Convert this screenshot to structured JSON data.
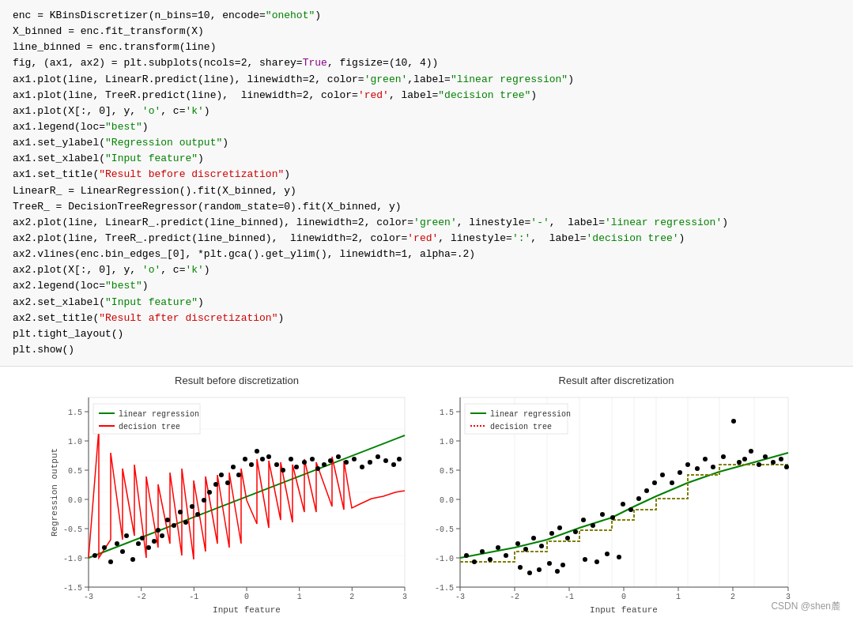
{
  "code": {
    "lines": [
      {
        "text": "enc = KBinsDiscretizer(n_bins=10, encode=\"onehot\")",
        "type": "plain"
      },
      {
        "text": "X_binned = enc.fit_transform(X)",
        "type": "plain"
      },
      {
        "text": "line_binned = enc.transform(line)",
        "type": "plain"
      },
      {
        "text": "fig, (ax1, ax2) = plt.subplots(ncols=2, sharey=True, figsize=(10, 4))",
        "type": "plain"
      },
      {
        "text": "ax1.plot(line, LinearR.predict(line), linewidth=2, color='green', label=\"linear regression\")",
        "type": "ax1_plot1"
      },
      {
        "text": "ax1.plot(line, TreeR.predict(line),  linewidth=2, color='red', label=\"decision tree\")",
        "type": "ax1_plot2"
      },
      {
        "text": "ax1.plot(X[:, 0], y, 'o', c='k')",
        "type": "plain"
      },
      {
        "text": "ax1.legend(loc=\"best\")",
        "type": "plain"
      },
      {
        "text": "ax1.set_ylabel(\"Regression output\")",
        "type": "plain"
      },
      {
        "text": "ax1.set_xlabel(\"Input feature\")",
        "type": "plain"
      },
      {
        "text": "ax1.set_title(\"Result before discretization\")",
        "type": "title_red"
      },
      {
        "text": "LinearR_ = LinearRegression().fit(X_binned, y)",
        "type": "plain"
      },
      {
        "text": "TreeR_ = DecisionTreeRegressor(random_state=0).fit(X_binned, y)",
        "type": "plain"
      },
      {
        "text": "ax2.plot(line, LinearR_.predict(line_binned), linewidth=2, color='green', linestyle='-', label='linear regression')",
        "type": "ax2_plot1"
      },
      {
        "text": "ax2.plot(line, TreeR_.predict(line_binned), linewidth=2, color='red', linestyle=':', label='decision tree')",
        "type": "ax2_plot2"
      },
      {
        "text": "ax2.vlines(enc.bin_edges_[0], *plt.gca().get_ylim(), linewidth=1, alpha=.2)",
        "type": "plain"
      },
      {
        "text": "ax2.plot(X[:, 0], y, 'o', c='k')",
        "type": "plain"
      },
      {
        "text": "ax2.legend(loc=\"best\")",
        "type": "plain"
      },
      {
        "text": "ax2.set_xlabel(\"Input feature\")",
        "type": "plain"
      },
      {
        "text": "ax2.set_title(\"Result after discretization\")",
        "type": "title_red"
      },
      {
        "text": "plt.tight_layout()",
        "type": "plain"
      },
      {
        "text": "plt.show()",
        "type": "plain"
      }
    ]
  },
  "charts": {
    "left": {
      "title": "Result before discretization",
      "ylabel": "Regression output",
      "xlabel": "Input feature",
      "legend": [
        "linear regression",
        "decision tree"
      ],
      "legend_colors": [
        "green",
        "red"
      ]
    },
    "right": {
      "title": "Result after discretization",
      "xlabel": "Input feature",
      "legend": [
        "linear regression",
        "decision tree"
      ],
      "legend_colors": [
        "green",
        "red"
      ],
      "legend_styles": [
        "solid",
        "dotted"
      ]
    }
  },
  "watermark": "CSDN @shen麓"
}
